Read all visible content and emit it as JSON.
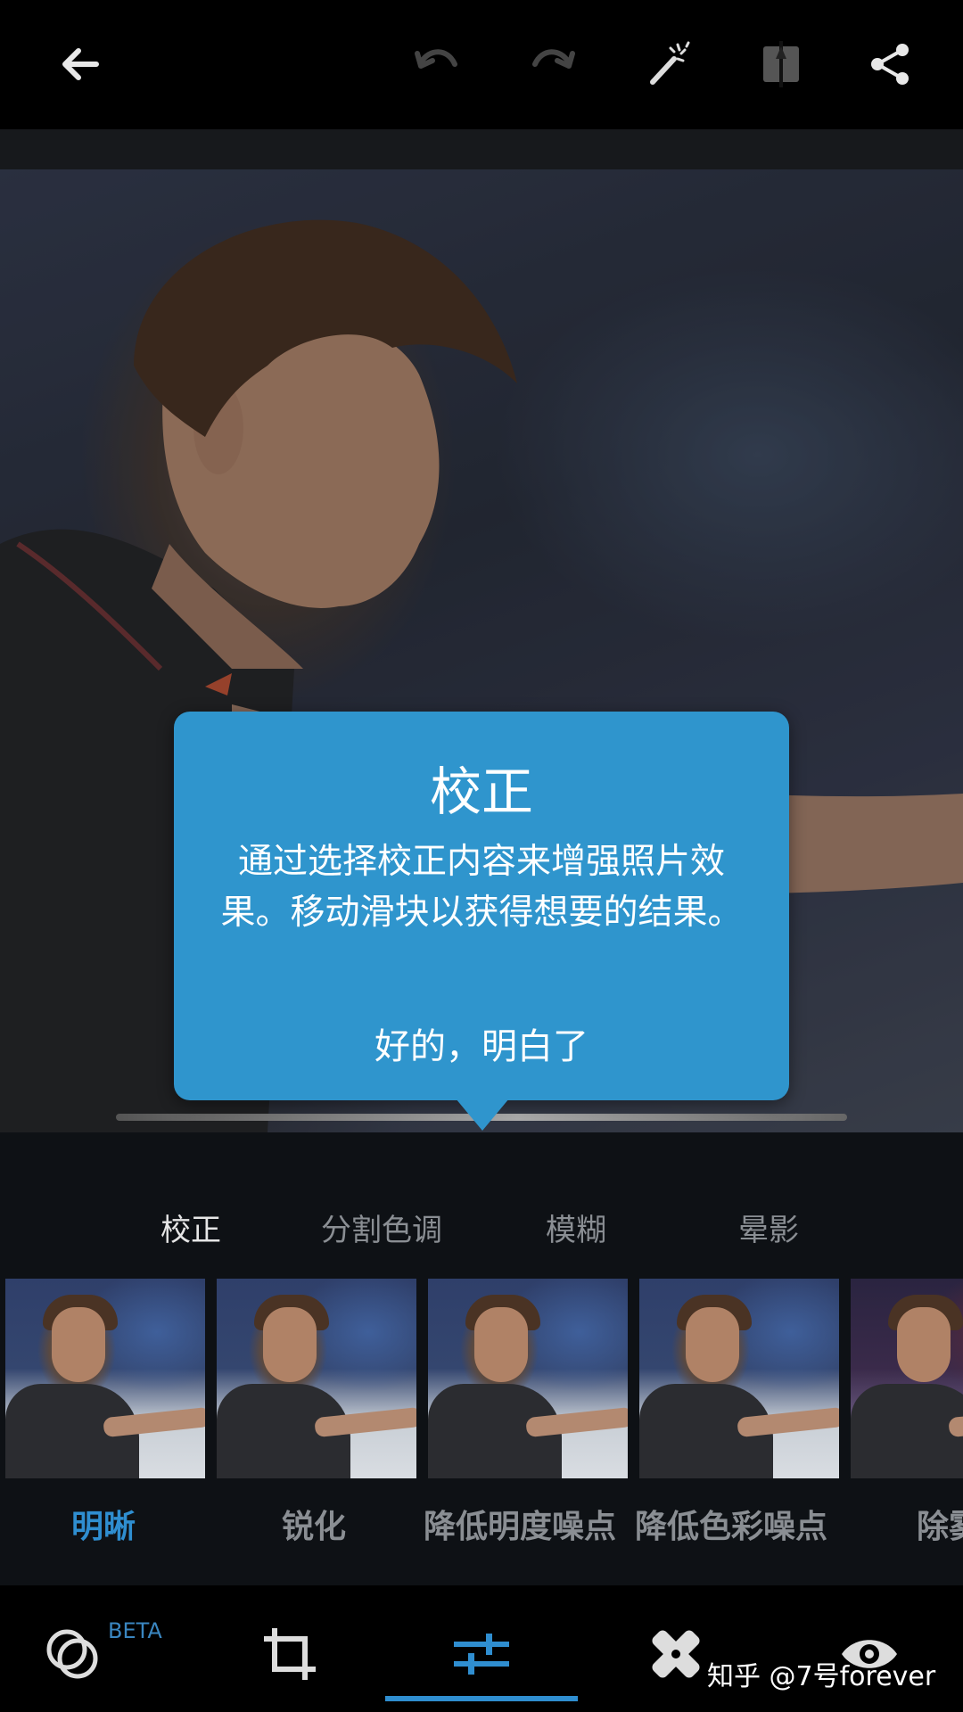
{
  "toolbar": {
    "back_icon": "arrow-left-icon",
    "undo_icon": "undo-icon",
    "redo_icon": "redo-icon",
    "auto_fix_icon": "magic-wand-icon",
    "compare_icon": "compare-icon",
    "share_icon": "share-icon"
  },
  "tooltip": {
    "title": "校正",
    "body": "通过选择校正内容来增强照片效果。移动滑块以获得想要的结果。",
    "ok_label": "好的，明白了"
  },
  "categories": [
    {
      "label": "校正",
      "active": true
    },
    {
      "label": "分割色调",
      "active": false
    },
    {
      "label": "模糊",
      "active": false
    },
    {
      "label": "晕影",
      "active": false
    }
  ],
  "adjustments": [
    {
      "label": "明晰",
      "active": true
    },
    {
      "label": "锐化",
      "active": false
    },
    {
      "label": "降低明度噪点",
      "active": false
    },
    {
      "label": "降低色彩噪点",
      "active": false
    },
    {
      "label": "除雾",
      "active": false
    }
  ],
  "bottom_nav": {
    "beta_label": "BETA",
    "items": [
      "looks-icon",
      "crop-icon",
      "adjustments-icon",
      "healing-icon",
      "eye-icon"
    ],
    "active": "adjustments-icon"
  },
  "watermark": "知乎 @7号forever",
  "colors": {
    "accent": "#2f8ed0",
    "tooltip_bg": "#2f95cd"
  }
}
